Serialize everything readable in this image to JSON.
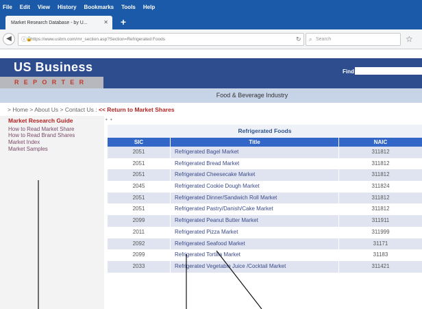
{
  "browser": {
    "menu": [
      "File",
      "Edit",
      "View",
      "History",
      "Bookmarks",
      "Tools",
      "Help"
    ],
    "tab_title": "Market Research Database - by U...",
    "url": "https://www.usbrn.com/mr_section.asp?Section=Refrigerated Foods",
    "search_placeholder": "Search"
  },
  "site": {
    "logo_top": "US Business",
    "logo_bottom": "REPORTER",
    "find_label": "Find",
    "industry": "Food & Beverage Industry",
    "breadcrumb": "> Home > About Us > Contact Us :",
    "return_link": "<< Return to Market Shares"
  },
  "leftnav": {
    "guide": "Market Research Guide",
    "links": [
      "How to Read Market Share",
      "How to Read Brand Shares",
      "Market Index",
      "Market Samples"
    ]
  },
  "table": {
    "title": "Refrigerated Foods",
    "headers": {
      "sic": "SIC",
      "title": "Title",
      "naic": "NAIC"
    },
    "rows": [
      {
        "sic": "2051",
        "title": "Refrigerated Bagel Market",
        "naic": "311812"
      },
      {
        "sic": "2051",
        "title": "Refrigerated Bread Market",
        "naic": "311812"
      },
      {
        "sic": "2051",
        "title": "Refrigerated Cheesecake Market",
        "naic": "311812"
      },
      {
        "sic": "2045",
        "title": "Refrigerated Cookie Dough Market",
        "naic": "311824"
      },
      {
        "sic": "2051",
        "title": "Refrigerated Dinner/Sandwich Roll Market",
        "naic": "311812"
      },
      {
        "sic": "2051",
        "title": "Refrigerated Pastry/Danish/Cake Market",
        "naic": "311812"
      },
      {
        "sic": "2099",
        "title": "Refrigerated Peanut Butter Market",
        "naic": "311911"
      },
      {
        "sic": "2011",
        "title": "Refrigerated Pizza Market",
        "naic": "311999"
      },
      {
        "sic": "2092",
        "title": "Refrigerated Seafood Market",
        "naic": "31171"
      },
      {
        "sic": "2099",
        "title": "Refrigerated Tortilla Market",
        "naic": "31183"
      },
      {
        "sic": "2033",
        "title": "Refrigerated Vegetable Juice /Cocktail Market",
        "naic": "311421"
      }
    ]
  },
  "colors": {
    "chrome": "#1b5aa8",
    "header": "#2e4d8f",
    "accent_red": "#b22222",
    "table_head": "#3267c7",
    "row_alt": "#dfe4f0"
  }
}
